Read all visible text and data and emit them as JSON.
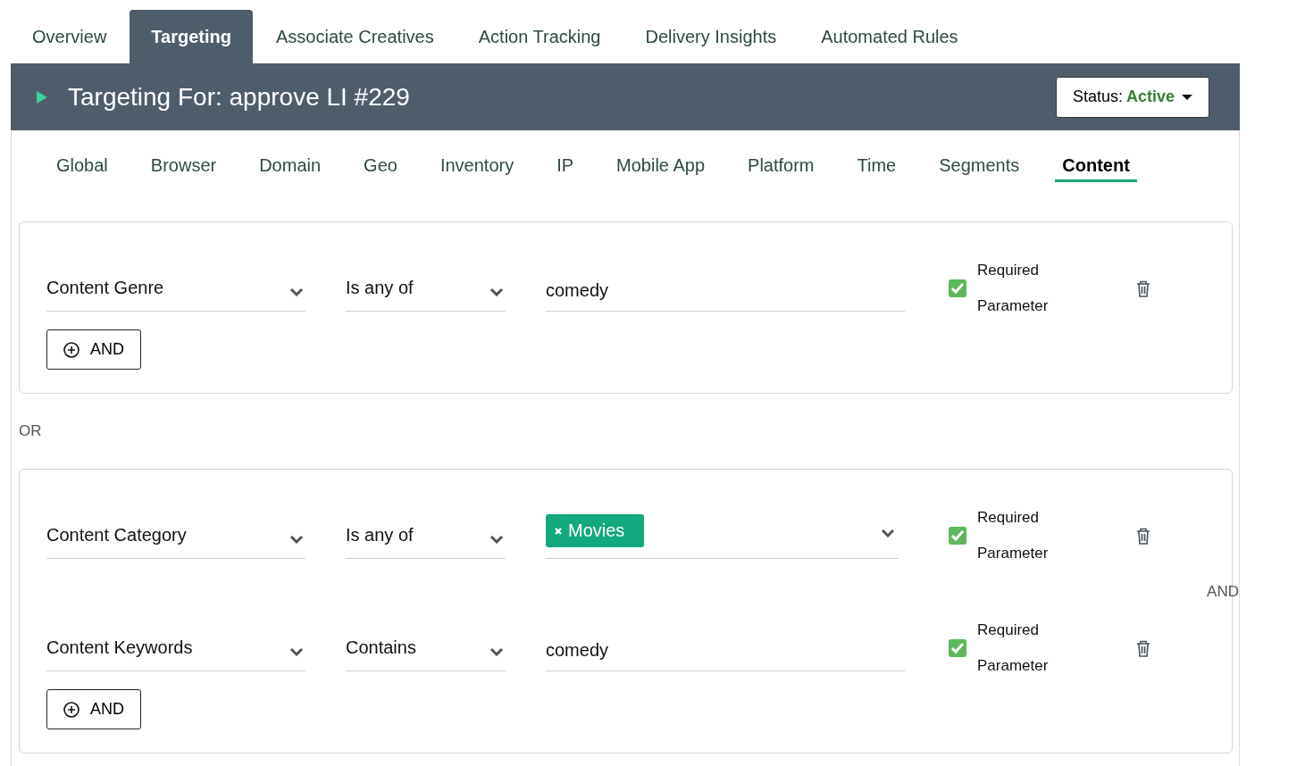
{
  "tabs": [
    {
      "label": "Overview",
      "selected": false
    },
    {
      "label": "Targeting",
      "selected": true
    },
    {
      "label": "Associate Creatives",
      "selected": false
    },
    {
      "label": "Action Tracking",
      "selected": false
    },
    {
      "label": "Delivery Insights",
      "selected": false
    },
    {
      "label": "Automated Rules",
      "selected": false
    }
  ],
  "header": {
    "title": "Targeting For: approve LI #229",
    "status_label": "Status:",
    "status_value": "Active"
  },
  "subtabs": [
    {
      "label": "Global",
      "selected": false
    },
    {
      "label": "Browser",
      "selected": false
    },
    {
      "label": "Domain",
      "selected": false
    },
    {
      "label": "Geo",
      "selected": false
    },
    {
      "label": "Inventory",
      "selected": false
    },
    {
      "label": "IP",
      "selected": false
    },
    {
      "label": "Mobile App",
      "selected": false
    },
    {
      "label": "Platform",
      "selected": false
    },
    {
      "label": "Time",
      "selected": false
    },
    {
      "label": "Segments",
      "selected": false
    },
    {
      "label": "Content",
      "selected": true
    }
  ],
  "group_separator": "OR",
  "groups": [
    {
      "conditions": [
        {
          "field": "Content Genre",
          "operator": "Is any of",
          "kind": "text",
          "value": "comedy",
          "required": true,
          "required_label": "Required Parameter"
        }
      ],
      "add_button": "AND"
    },
    {
      "conditions": [
        {
          "field": "Content Category",
          "operator": "Is any of",
          "kind": "tags",
          "tags": [
            "Movies"
          ],
          "required": true,
          "required_label": "Required Parameter"
        },
        {
          "field": "Content Keywords",
          "operator": "Contains",
          "kind": "text",
          "value": "comedy",
          "required": true,
          "required_label": "Required Parameter"
        }
      ],
      "condition_joiner": "AND",
      "add_button": "AND"
    }
  ]
}
